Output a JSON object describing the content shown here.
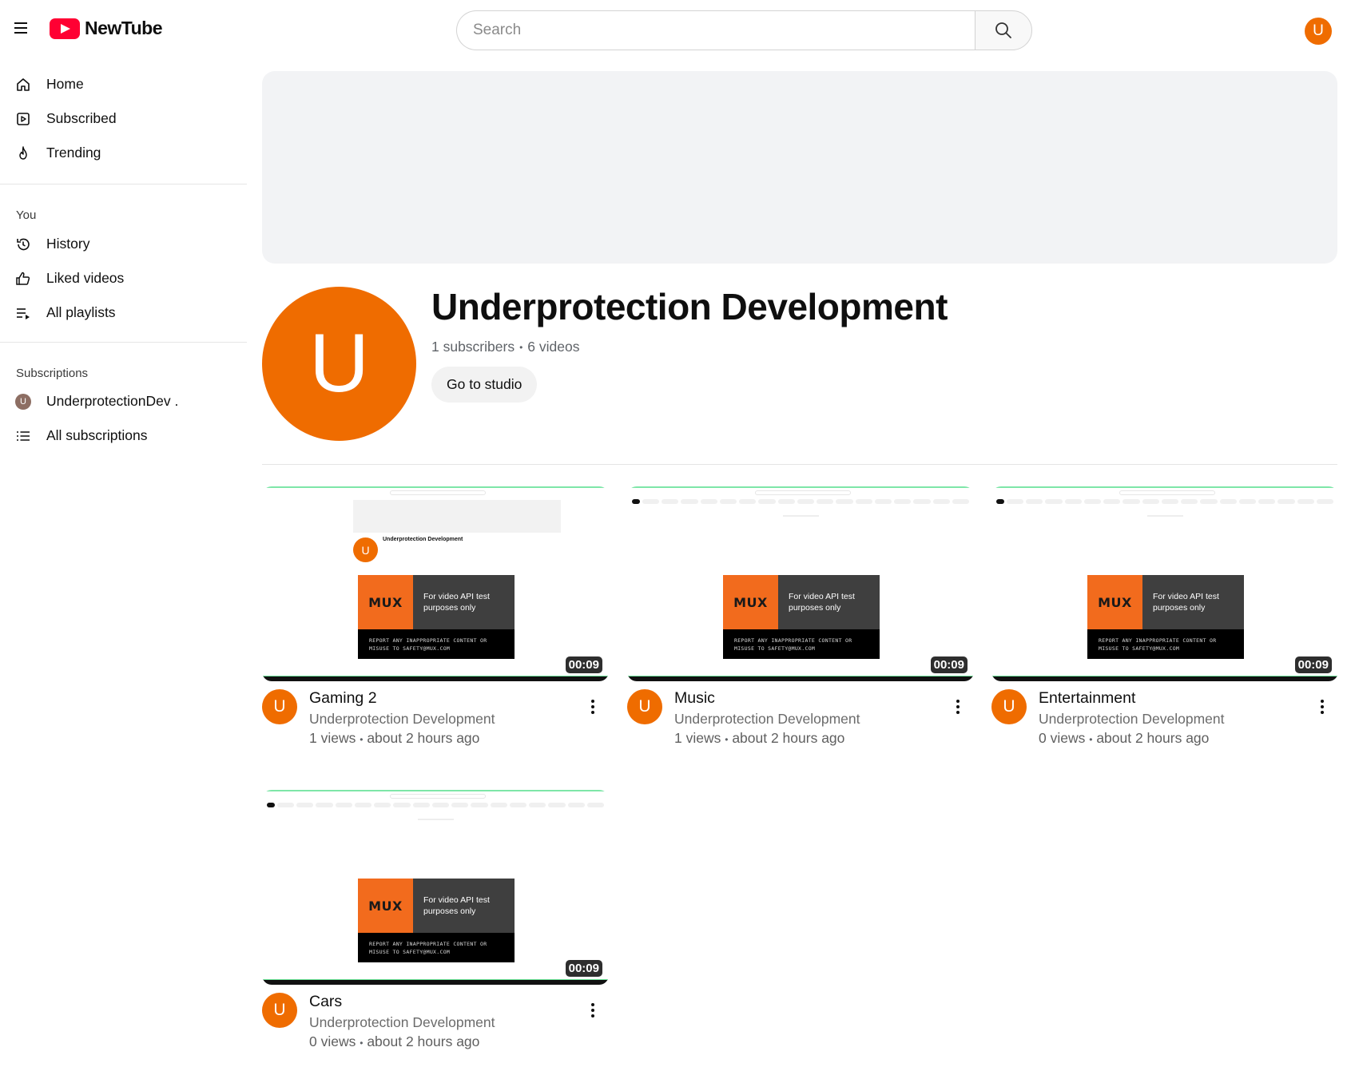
{
  "header": {
    "logo_text": "NewTube",
    "search_placeholder": "Search",
    "user_avatar_letter": "U"
  },
  "sidebar": {
    "main": [
      {
        "label": "Home",
        "icon": "home-icon"
      },
      {
        "label": "Subscribed",
        "icon": "subscriptions-icon"
      },
      {
        "label": "Trending",
        "icon": "flame-icon"
      }
    ],
    "you_title": "You",
    "you": [
      {
        "label": "History",
        "icon": "history-icon"
      },
      {
        "label": "Liked videos",
        "icon": "thumbs-up-icon"
      },
      {
        "label": "All playlists",
        "icon": "playlist-icon"
      }
    ],
    "subs_title": "Subscriptions",
    "subs": [
      {
        "label": "UnderprotectionDev .",
        "avatar_letter": "U"
      },
      {
        "label": "All subscriptions",
        "icon": "list-icon"
      }
    ]
  },
  "channel": {
    "avatar_letter": "U",
    "name": "Underprotection Development",
    "subscribers": "1 subscribers",
    "videos": "6 videos",
    "studio_button": "Go to studio"
  },
  "thumbnail_overlay": {
    "mux_logo": "MUX",
    "mux_line1": "For video API test",
    "mux_line2": "purposes only",
    "mux_notice1": "REPORT ANY INAPPROPRIATE CONTENT OR",
    "mux_notice2": "MISUSE TO SAFETY@MUX.COM",
    "mini_channel_name": "Underprotection Development"
  },
  "videos": [
    {
      "title": "Gaming 2",
      "channel": "Underprotection Development",
      "views": "1 views",
      "age": "about 2 hours ago",
      "duration": "00:09",
      "avatar_letter": "U"
    },
    {
      "title": "Music",
      "channel": "Underprotection Development",
      "views": "1 views",
      "age": "about 2 hours ago",
      "duration": "00:09",
      "avatar_letter": "U"
    },
    {
      "title": "Entertainment",
      "channel": "Underprotection Development",
      "views": "0 views",
      "age": "about 2 hours ago",
      "duration": "00:09",
      "avatar_letter": "U"
    },
    {
      "title": "Cars",
      "channel": "Underprotection Development",
      "views": "0 views",
      "age": "about 2 hours ago",
      "duration": "00:09",
      "avatar_letter": "U"
    }
  ],
  "colors": {
    "brand_red": "#ff0033",
    "avatar_orange": "#ef6c00"
  }
}
